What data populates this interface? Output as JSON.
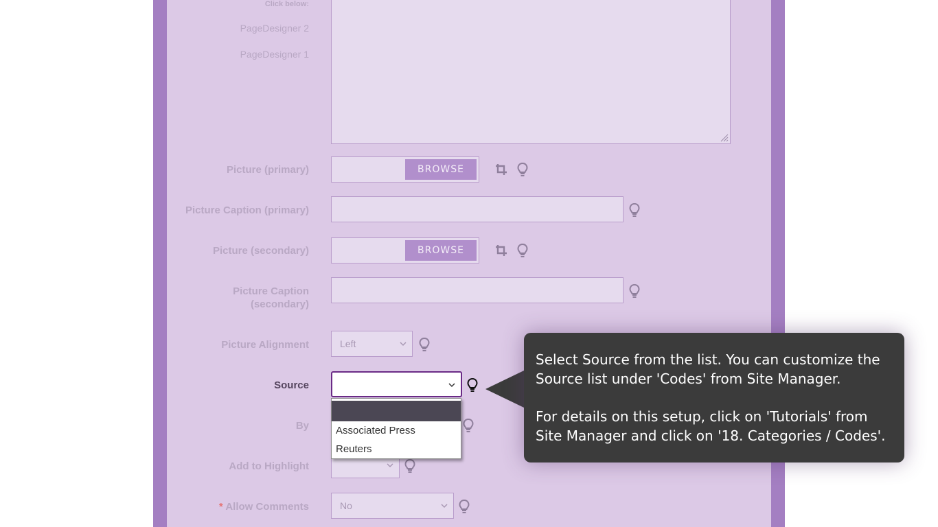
{
  "sidebar_links": {
    "click_below": "Click below:",
    "pagedesigner2": "PageDesigner 2",
    "pagedesigner1": "PageDesigner 1"
  },
  "fields": {
    "picture_primary": {
      "label": "Picture (primary)",
      "button": "BROWSE"
    },
    "caption_primary": {
      "label": "Picture Caption (primary)"
    },
    "picture_secondary": {
      "label": "Picture (secondary)",
      "button": "BROWSE"
    },
    "caption_secondary": {
      "label_line1": "Picture Caption",
      "label_line2": "(secondary)"
    },
    "alignment": {
      "label": "Picture Alignment",
      "value": "Left"
    },
    "source": {
      "label": "Source",
      "value": "",
      "options": [
        "",
        "Associated Press",
        "Reuters"
      ]
    },
    "by": {
      "label": "By"
    },
    "highlight": {
      "label": "Add to Highlight"
    },
    "comments": {
      "required_mark": "*",
      "label": "Allow Comments",
      "value": "No"
    }
  },
  "tooltip": {
    "line1": "Select Source from the list. You can customize the Source list under 'Codes' from Site Manager.",
    "line2": "For details on this setup, click on 'Tutorials' from Site Manager and click on '18. Categories / Codes'."
  },
  "colors": {
    "frame": "#a47fc2",
    "panel": "#dcc9e6",
    "button": "#b18fcc",
    "tooltip_bg": "#3b3b3b"
  },
  "icons": [
    "crop-icon",
    "lightbulb-icon",
    "chevron-down-icon",
    "resize-handle-icon"
  ]
}
